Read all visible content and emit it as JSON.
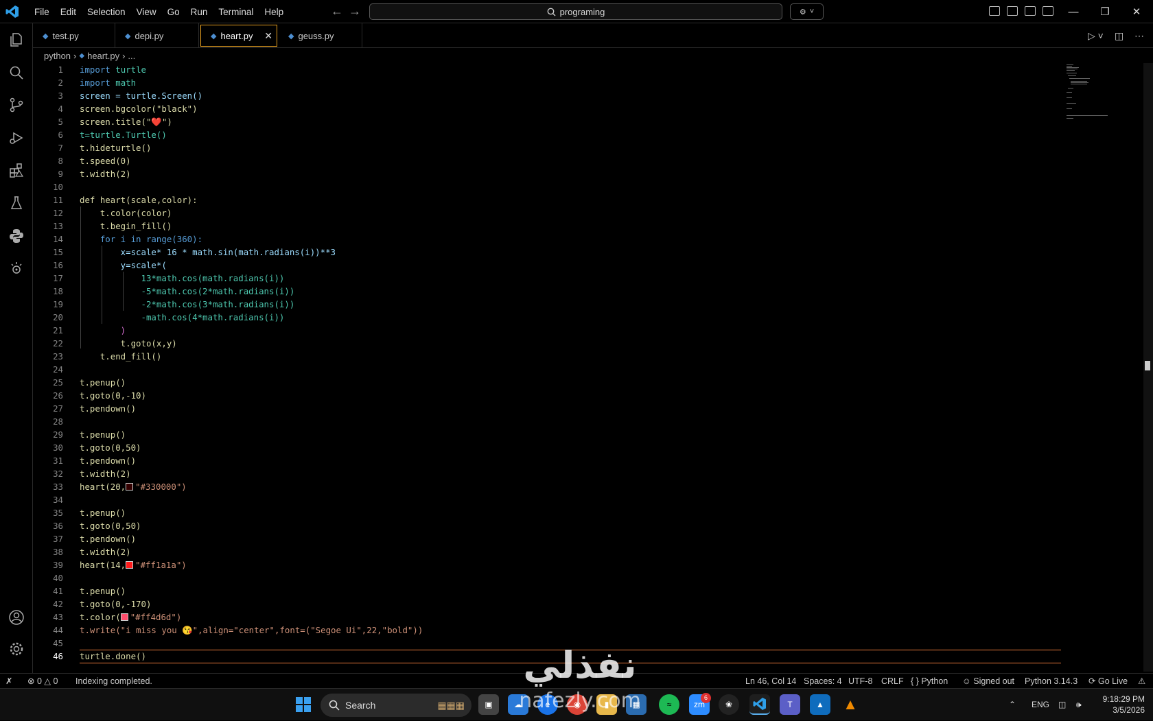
{
  "menu": {
    "file": "File",
    "edit": "Edit",
    "selection": "Selection",
    "view": "View",
    "go": "Go",
    "run": "Run",
    "terminal": "Terminal",
    "help": "Help"
  },
  "search": {
    "text": "programing"
  },
  "tabs": [
    {
      "label": "test.py"
    },
    {
      "label": "depi.py"
    },
    {
      "label": "heart.py"
    },
    {
      "label": "geuss.py"
    }
  ],
  "breadcrumb": {
    "folder": "python",
    "file": "heart.py",
    "more": "..."
  },
  "code": {
    "l1": "1",
    "l2": "2",
    "l3": "3",
    "l4": "4",
    "l5": "5",
    "l6": "6",
    "l7": "7",
    "l8": "8",
    "l9": "9",
    "l10": "10",
    "l11": "11",
    "l12": "12",
    "l13": "13",
    "l14": "14",
    "l15": "15",
    "l16": "16",
    "l17": "17",
    "l18": "18",
    "l19": "19",
    "l20": "20",
    "l21": "21",
    "l22": "22",
    "l23": "23",
    "l24": "24",
    "l25": "25",
    "l26": "26",
    "l27": "27",
    "l28": "28",
    "l29": "29",
    "l30": "30",
    "l31": "31",
    "l32": "32",
    "l33": "33",
    "l34": "34",
    "l35": "35",
    "l36": "36",
    "l37": "37",
    "l38": "38",
    "l39": "39",
    "l40": "40",
    "l41": "41",
    "l42": "42",
    "l43": "43",
    "l44": "44",
    "l45": "45",
    "l46": "46",
    "c1": "import turtle",
    "c2": "import math",
    "c3": "screen = turtle.Screen()",
    "c4": "screen.bgcolor(\"black\")",
    "c5": "screen.title(\"❤️\")",
    "c6": "t=turtle.Turtle()",
    "c7": "t.hideturtle()",
    "c8": "t.speed(0)",
    "c9": "t.width(2)",
    "c11": "def heart(scale,color):",
    "c12": "    t.color(color)",
    "c13": "    t.begin_fill()",
    "c14": "    for i in range(360):",
    "c15": "        x=scale* 16 * math.sin(math.radians(i))**3",
    "c16": "        y=scale*(",
    "c17": "            13*math.cos(math.radians(i))",
    "c18": "            -5*math.cos(2*math.radians(i))",
    "c19": "            -2*math.cos(3*math.radians(i))",
    "c20": "            -math.cos(4*math.radians(i))",
    "c21": "        )",
    "c22": "        t.goto(x,y)",
    "c23": "    t.end_fill()",
    "c25": "t.penup()",
    "c26": "t.goto(0,-10)",
    "c27": "t.pendown()",
    "c29": "t.penup()",
    "c30": "t.goto(0,50)",
    "c31": "t.pendown()",
    "c32": "t.width(2)",
    "c33a": "heart(20,",
    "c33b": "\"#330000\")",
    "c35": "t.penup()",
    "c36": "t.goto(0,50)",
    "c37": "t.pendown()",
    "c38": "t.width(2)",
    "c39a": "heart(14,",
    "c39b": "\"#ff1a1a\")",
    "c41": "t.penup()",
    "c42": "t.goto(0,-170)",
    "c43a": "t.color(",
    "c43b": "\"#ff4d6d\")",
    "c44": "t.write(\"i miss you 😘\",align=\"center\",font=(\"Segoe Ui\",22,\"bold\"))",
    "c46": "turtle.done()"
  },
  "swatches": {
    "s33": "#330000",
    "s39": "#ff1a1a",
    "s43": "#ff4d6d"
  },
  "status": {
    "errors": "0",
    "warnings": "0",
    "message": "Indexing completed.",
    "position": "Ln 46, Col 14",
    "spaces": "Spaces: 4",
    "encoding": "UTF-8",
    "eol": "CRLF",
    "language": "Python",
    "signed": "Signed out",
    "interpreter": "Python 3.14.3",
    "golive": "Go Live"
  },
  "taskbar": {
    "search": "Search",
    "zoom_badge": "6",
    "lang": "ENG",
    "time": "9:18:29 PM",
    "date": "3/5/2026"
  },
  "watermark": {
    "arabic": "نفذلي",
    "latin": "nafezly.com"
  },
  "colors": {
    "accent": "#e8a020",
    "cursorline": "#ec7a3b"
  }
}
